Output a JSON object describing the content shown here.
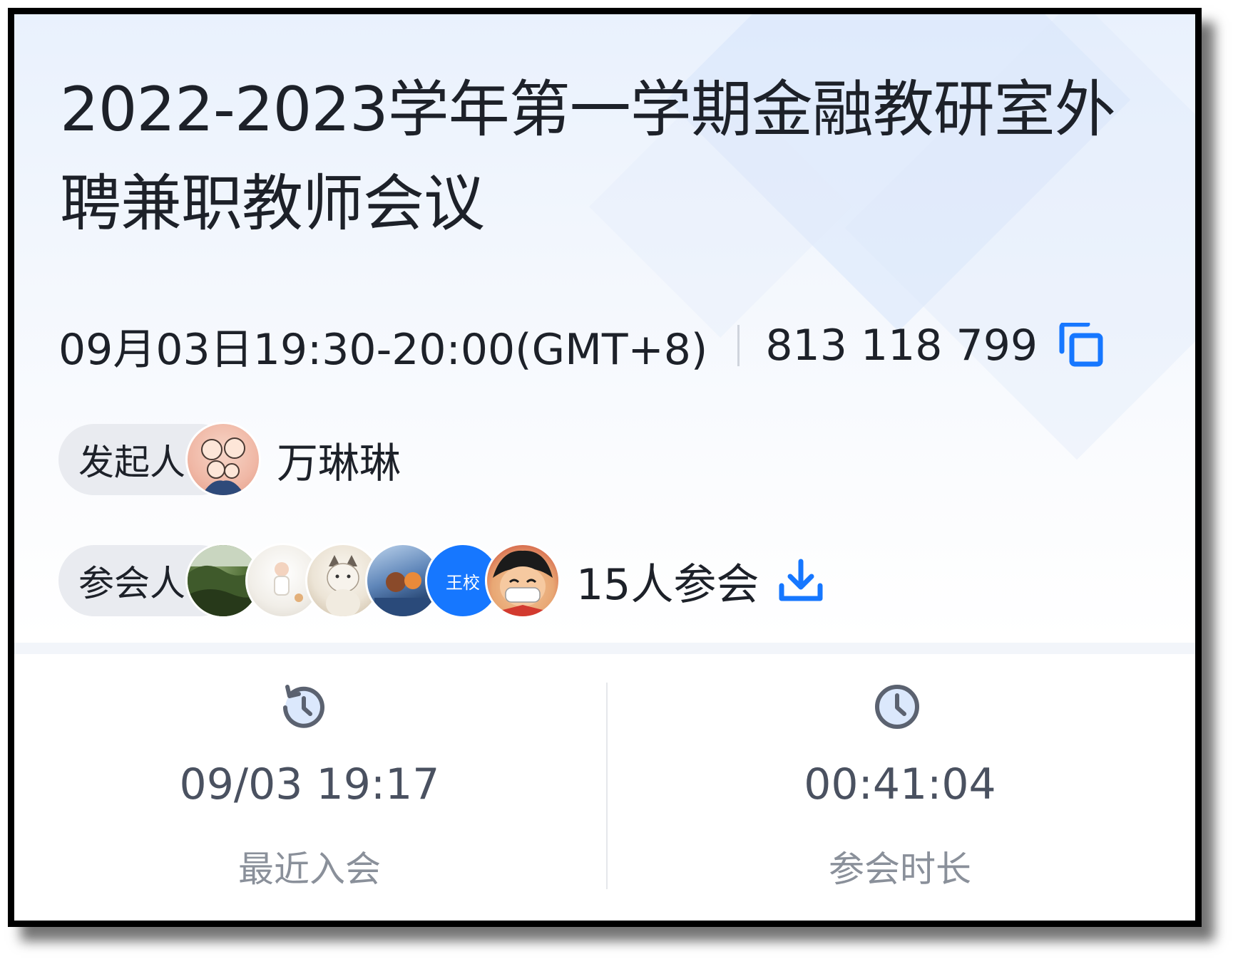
{
  "meeting": {
    "title": "2022-2023学年第一学期金融教研室外聘兼职教师会议",
    "time": "09月03日19:30-20:00(GMT+8)",
    "meeting_id": "813 118 799",
    "organizer": {
      "label": "发起人",
      "name": "万琳琳"
    },
    "attendees": {
      "label": "参会人",
      "text_avatar": "王校",
      "count_text": "15人参会"
    }
  },
  "stats": {
    "recent_join": {
      "value": "09/03 19:17",
      "label": "最近入会"
    },
    "duration": {
      "value": "00:41:04",
      "label": "参会时长"
    }
  },
  "colors": {
    "accent": "#1677ff",
    "text_primary": "#1d2129",
    "text_secondary": "#8a909a"
  },
  "icons": {
    "copy": "copy-icon",
    "download": "download-icon",
    "history": "history-icon",
    "clock": "clock-icon"
  }
}
